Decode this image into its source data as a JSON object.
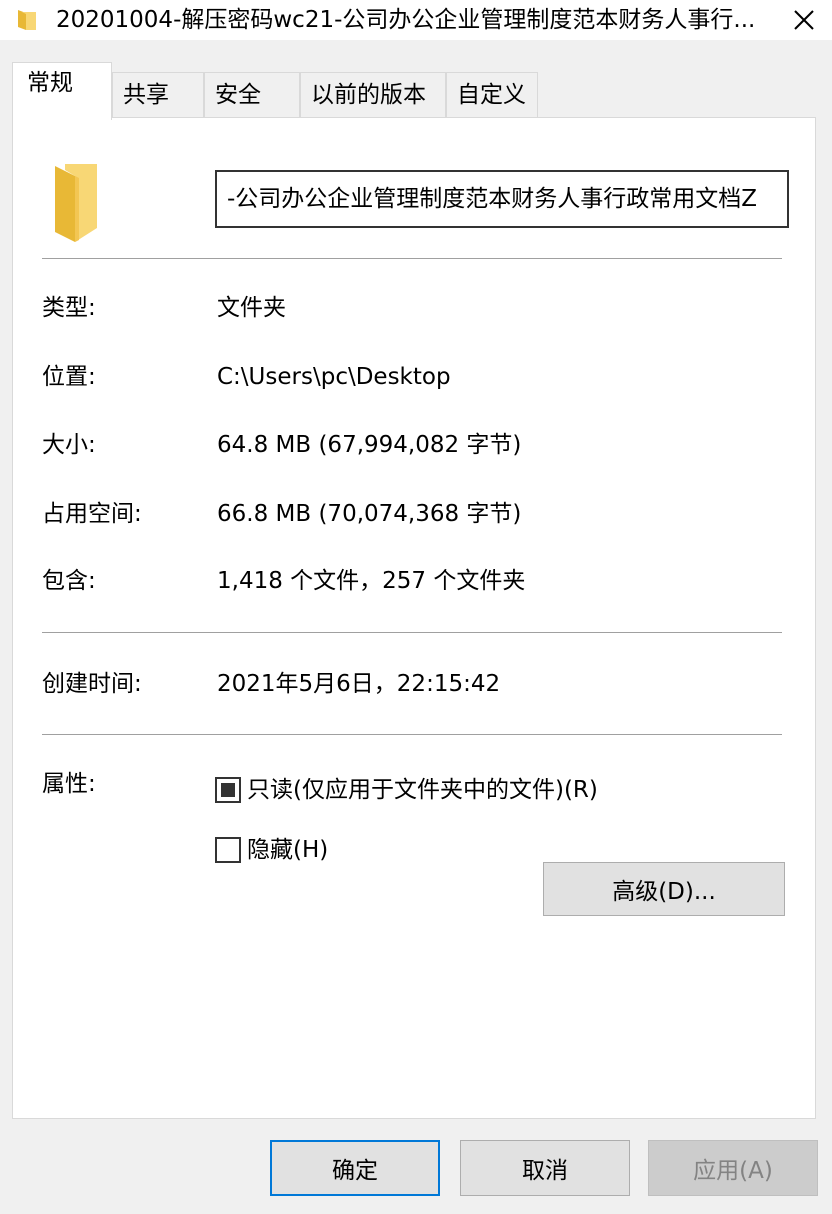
{
  "window": {
    "title": "20201004-解压密码wc21-公司办公企业管理制度范本财务人事行...",
    "close_glyph": "✕"
  },
  "tabs": [
    {
      "label": "常规",
      "active": true
    },
    {
      "label": "共享",
      "active": false
    },
    {
      "label": "安全",
      "active": false
    },
    {
      "label": "以前的版本",
      "active": false
    },
    {
      "label": "自定义",
      "active": false
    }
  ],
  "general": {
    "folder_name": "-公司办公企业管理制度范本财务人事行政常用文档Z",
    "type_label": "类型:",
    "type_value": "文件夹",
    "location_label": "位置:",
    "location_value": "C:\\Users\\pc\\Desktop",
    "size_label": "大小:",
    "size_value": "64.8 MB (67,994,082 字节)",
    "disk_size_label": "占用空间:",
    "disk_size_value": "66.8 MB (70,074,368 字节)",
    "contains_label": "包含:",
    "contains_value": "1,418 个文件，257 个文件夹",
    "created_label": "创建时间:",
    "created_value": "2021年5月6日，22:15:42",
    "attributes_label": "属性:",
    "readonly_label": "只读(仅应用于文件夹中的文件)(R)",
    "readonly_state": "indeterminate",
    "hidden_label": "隐藏(H)",
    "hidden_checked": false,
    "advanced_label": "高级(D)..."
  },
  "footer": {
    "ok_label": "确定",
    "cancel_label": "取消",
    "apply_label": "应用(A)"
  },
  "colors": {
    "folder_yellow": "#f8d775",
    "folder_dark": "#e8b836",
    "default_button_border": "#0078d7"
  }
}
